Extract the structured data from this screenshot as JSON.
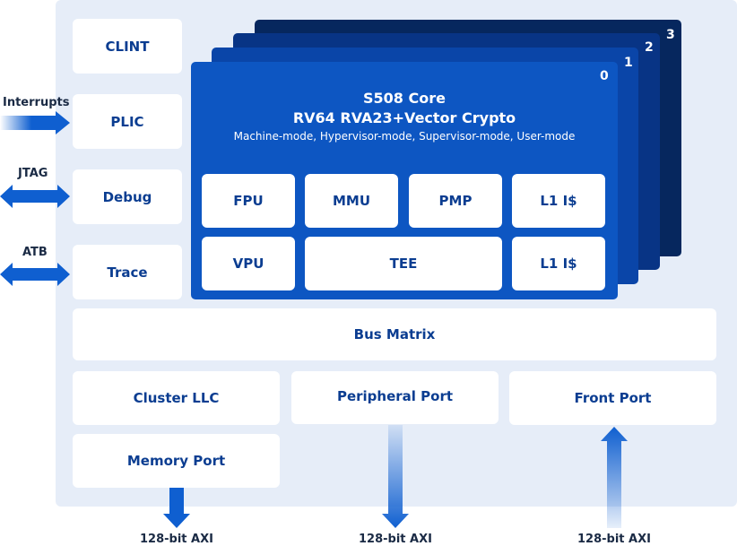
{
  "left_blocks": {
    "clint": "CLINT",
    "plic": "PLIC",
    "debug": "Debug",
    "trace": "Trace"
  },
  "external": {
    "interrupts": "Interrupts",
    "jtag": "JTAG",
    "atb": "ATB"
  },
  "core": {
    "layers": [
      "0",
      "1",
      "2",
      "3"
    ],
    "name": "S508 Core",
    "isa": "RV64 RVA23+Vector Crypto",
    "modes": "Machine-mode, Hypervisor-mode, Supervisor-mode, User-mode",
    "units": {
      "fpu": "FPU",
      "mmu": "MMU",
      "pmp": "PMP",
      "l1_icache_1": "L1 I$",
      "vpu": "VPU",
      "tee": "TEE",
      "l1_icache_2": "L1 I$"
    }
  },
  "bus_matrix": "Bus Matrix",
  "bottom_blocks": {
    "cluster_llc": "Cluster LLC",
    "peripheral_port": "Peripheral Port",
    "front_port": "Front Port",
    "memory_port": "Memory Port"
  },
  "axi_labels": [
    "128-bit AXI",
    "128-bit AXI",
    "128-bit AXI"
  ],
  "colors": {
    "panel": "#e6edf8",
    "core_front": "#0d56c2",
    "layer_1": "#0a45a8",
    "layer_2": "#083485",
    "layer_3": "#06275e",
    "arrow": "#0f5fd0",
    "text": "#0b3d91"
  }
}
